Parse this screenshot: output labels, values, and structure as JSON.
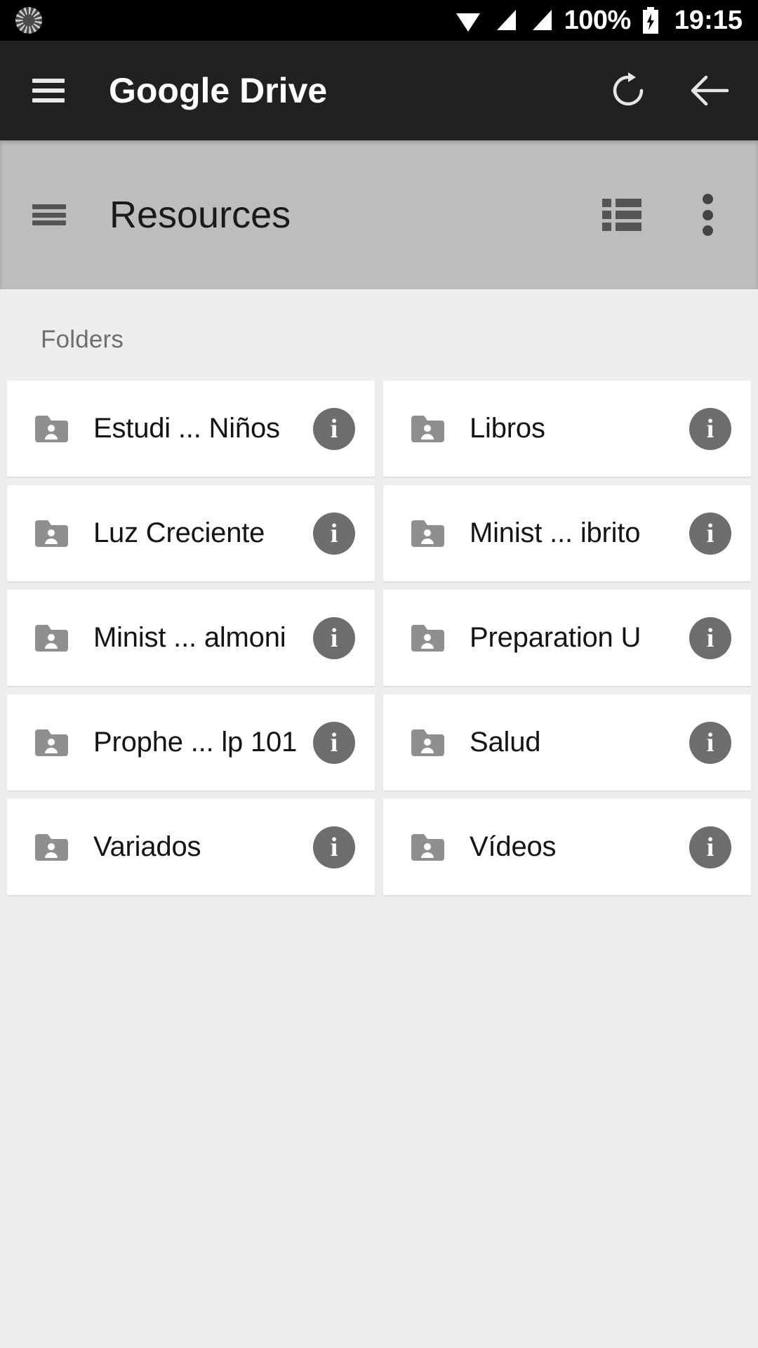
{
  "status_bar": {
    "sync_icon": "spinner-icon",
    "wifi_icon": "wifi-icon",
    "signal_icon_1": "signal-bars-icon",
    "signal_icon_2": "signal-bars-icon",
    "battery_percent": "100%",
    "battery_icon": "battery-charging-icon",
    "time": "19:15"
  },
  "app_bar": {
    "menu_icon": "hamburger-menu-icon",
    "title": "Google Drive",
    "refresh_icon": "refresh-icon",
    "back_icon": "arrow-left-icon",
    "background_color": "#212121"
  },
  "sub_toolbar": {
    "menu_icon": "hamburger-menu-icon",
    "title": "Resources",
    "list_view_icon": "list-view-icon",
    "overflow_icon": "more-vertical-icon",
    "background_color": "#bdbdbd"
  },
  "content": {
    "section_label": "Folders",
    "folder_icon": "shared-folder-icon",
    "info_icon_label": "i",
    "folders": [
      {
        "name": "Estudi ... Niños"
      },
      {
        "name": "Libros"
      },
      {
        "name": "Luz Creciente"
      },
      {
        "name": "Minist ... ibrito"
      },
      {
        "name": "Minist ... almoni"
      },
      {
        "name": "Preparation U"
      },
      {
        "name": "Prophe ... lp 101"
      },
      {
        "name": "Salud"
      },
      {
        "name": "Variados"
      },
      {
        "name": "Vídeos"
      }
    ]
  },
  "colors": {
    "status_bar_bg": "#000000",
    "app_bar_bg": "#212121",
    "toolbar_bg": "#bdbdbd",
    "page_bg": "#eeeeee",
    "card_bg": "#ffffff",
    "icon_gray": "#6e6e6e"
  }
}
